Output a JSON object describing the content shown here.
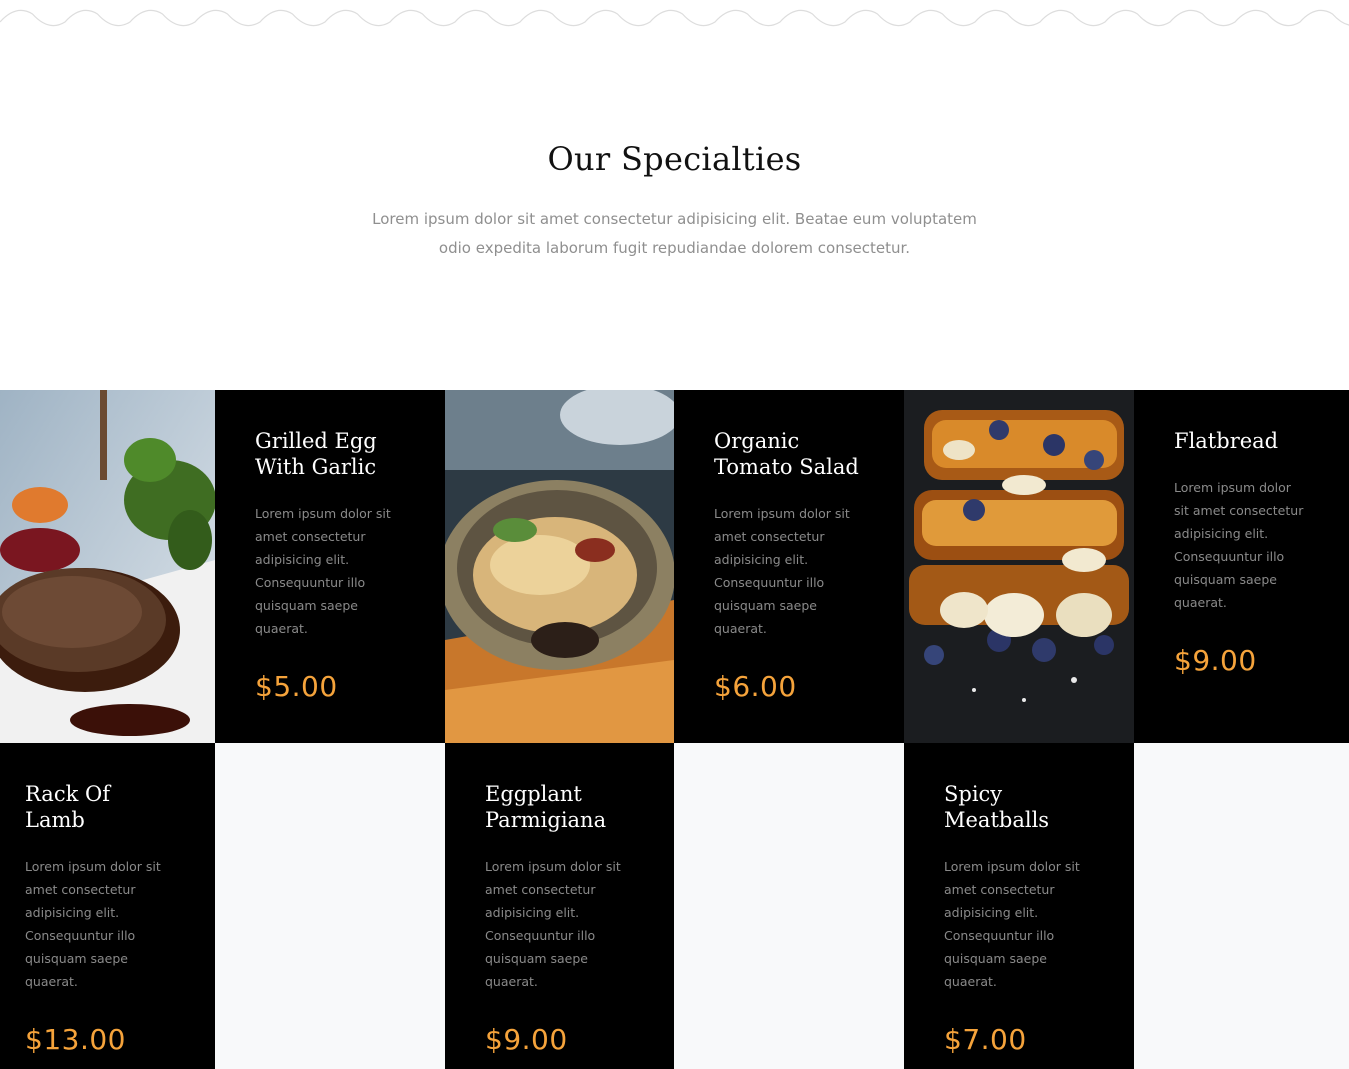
{
  "section": {
    "title": "Our Specialties",
    "subtitle": "Lorem ipsum dolor sit amet consectetur adipisicing elit. Beatae eum voluptatem odio expedita laborum fugit repudiandae dolorem consectetur."
  },
  "dishes": [
    {
      "name": "Grilled Egg\nWith Garlic",
      "description": "Lorem ipsum dolor sit amet consectetur adipisicing elit. Consequuntur illo quisquam saepe quaerat.",
      "price": "$5.00"
    },
    {
      "name": "Organic\nTomato Salad",
      "description": "Lorem ipsum dolor sit amet consectetur adipisicing elit. Consequuntur illo quisquam saepe quaerat.",
      "price": "$6.00"
    },
    {
      "name": "Flatbread",
      "description": "Lorem ipsum dolor sit amet consectetur adipisicing elit. Consequuntur illo quisquam saepe quaerat.",
      "price": "$9.00"
    },
    {
      "name": "Rack Of Lamb",
      "description": "Lorem ipsum dolor sit amet consectetur adipisicing elit. Consequuntur illo quisquam saepe quaerat.",
      "price": "$13.00"
    },
    {
      "name": "Eggplant\nParmigiana",
      "description": "Lorem ipsum dolor sit amet consectetur adipisicing elit. Consequuntur illo quisquam saepe quaerat.",
      "price": "$9.00"
    },
    {
      "name": "Spicy\nMeatballs",
      "description": "Lorem ipsum dolor sit amet consectetur adipisicing elit. Consequuntur illo quisquam saepe quaerat.",
      "price": "$7.00"
    }
  ],
  "colors": {
    "accent": "#f5a33b",
    "card_bg": "#000000",
    "empty_bg": "#f8f9fa"
  }
}
